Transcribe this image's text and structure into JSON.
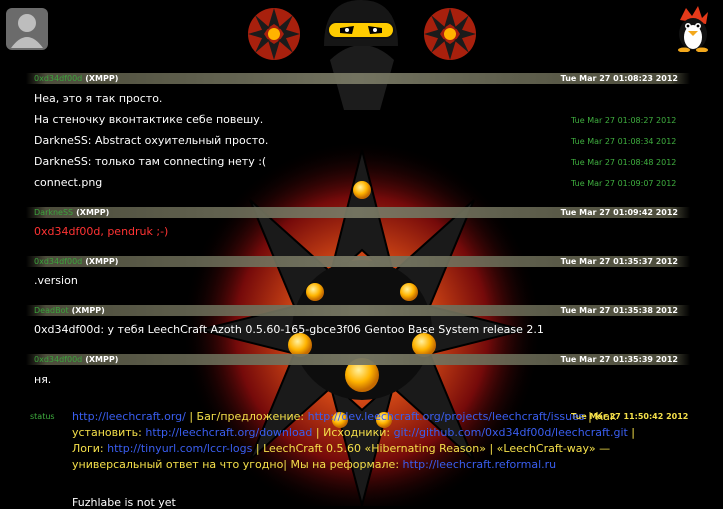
{
  "colors": {
    "header_nick": "#3ca53c",
    "timestamp_inline": "#3fae3f",
    "highlight_text": "#ff3333",
    "status_text": "#f5e04a",
    "link": "#3a5ef0"
  },
  "icons": {
    "left_avatar": "user-silhouette-icon",
    "right_avatar": "tux-penguin-icon"
  },
  "messages": [
    {
      "nick": "0xd34df00d",
      "proto": "(XMPP)",
      "time": "Tue Mar 27 01:08:23 2012",
      "lines": [
        {
          "text": "Неа, это я так просто.",
          "time": ""
        },
        {
          "text": "На стеночку вконтактике себе повешу.",
          "time": "Tue Mar 27 01:08:27 2012"
        },
        {
          "text": "DarkneSS: Abstract охуительный просто.",
          "time": "Tue Mar 27 01:08:34 2012"
        },
        {
          "text": "DarkneSS: только там connecting нету :(",
          "time": "Tue Mar 27 01:08:48 2012"
        },
        {
          "text": "connect.png",
          "time": "Tue Mar 27 01:09:07 2012"
        }
      ]
    },
    {
      "nick": "DarkneSS",
      "proto": "(XMPP)",
      "time": "Tue Mar 27 01:09:42 2012",
      "lines": [
        {
          "text": "0xd34df00d, pendruk ;-)",
          "time": ""
        }
      ]
    },
    {
      "nick": "0xd34df00d",
      "proto": "(XMPP)",
      "time": "Tue Mar 27 01:35:37 2012",
      "lines": [
        {
          "text": ".version",
          "time": ""
        }
      ]
    },
    {
      "nick": "DeadBot",
      "proto": "(XMPP)",
      "time": "Tue Mar 27 01:35:38 2012",
      "lines": [
        {
          "text": "0xd34df00d: у тебя LeechCraft Azoth 0.5.60-165-gbce3f06 Gentoo Base System release 2.1",
          "time": ""
        }
      ]
    },
    {
      "nick": "0xd34df00d",
      "proto": "(XMPP)",
      "time": "Tue Mar 27 01:35:39 2012",
      "lines": [
        {
          "text": "ня.",
          "time": ""
        }
      ]
    }
  ],
  "status": {
    "label": "status",
    "time": "Tue Mar 27 11:50:42 2012",
    "link_main": "http://leechcraft.org/",
    "bug_text": " | Баг/предложение:",
    "link_issues": "http://dev.leechcraft.org/projects/leechcraft/issues",
    "install_text": " | Как установить: ",
    "link_download": "http://leechcraft.org/download",
    "sources_text": " | Исходники: ",
    "link_git": "git://github.com/0xd34df00d/leechcraft.git",
    "logs_text": " | Логи: ",
    "link_logs": "http://tinyurl.com/lccr-logs",
    "release_text": " | LeechCraft 0.5.60 «Hibernating Reason» | «LeechCraft-way» — универсальный ответ на что угодно| Мы на реформале: ",
    "link_reformal": "http://leechcraft.reformal.ru",
    "extra_line": "Fuzhlabe is not yet"
  }
}
